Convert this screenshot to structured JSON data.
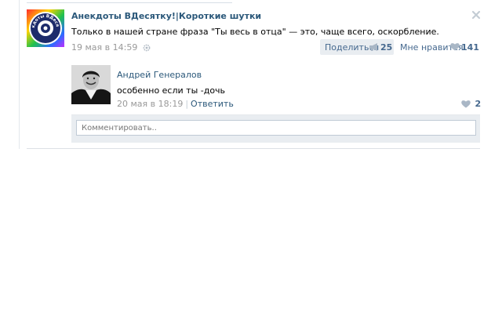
{
  "post": {
    "group_name": "Анекдоты ВДесятку!|Короткие шутки",
    "avatar_text": "Анекдоты ВДесятку!",
    "text": "Только в нашей стране фраза \"Ты весь в отца\" — это, чаще всего, оскорбление.",
    "date": "19 мая в 14:59",
    "share_label": "Поделиться",
    "share_count": "25",
    "like_label": "Мне нравится",
    "like_count": "141"
  },
  "comment": {
    "author": "Андрей Генералов",
    "text": "особенно если ты -дочь",
    "date": "20 мая в 18:19",
    "separator": "|",
    "reply_label": "Ответить",
    "like_count": "2"
  },
  "comment_input": {
    "placeholder": "Комментировать.."
  },
  "colors": {
    "link": "#2b587a",
    "accent": "#45688e",
    "muted": "#999999",
    "panel": "#e9edf1"
  },
  "icons": [
    "close-icon",
    "gear-icon",
    "megaphone-icon",
    "heart-icon"
  ]
}
